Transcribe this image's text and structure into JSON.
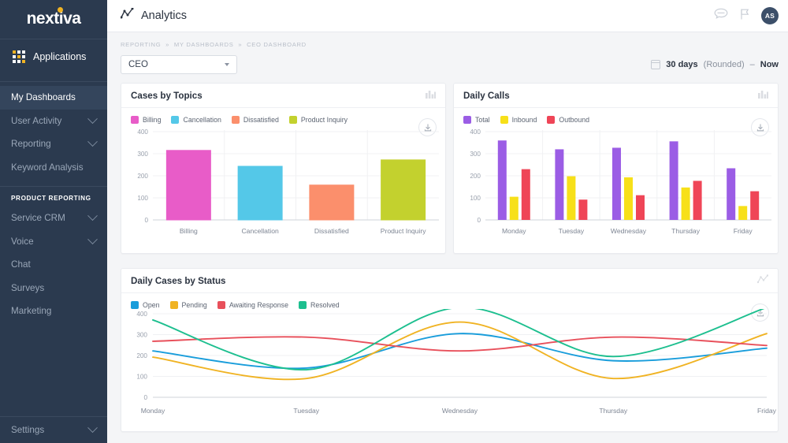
{
  "sidebar": {
    "logo": "nextiva",
    "applications": {
      "label": "Applications",
      "icon": "grid-icon"
    },
    "items": [
      {
        "label": "My Dashboards",
        "active": true,
        "chevron": false
      },
      {
        "label": "User Activity",
        "active": false,
        "chevron": true
      },
      {
        "label": "Reporting",
        "active": false,
        "chevron": true
      },
      {
        "label": "Keyword Analysis",
        "active": false,
        "chevron": false
      }
    ],
    "section_label": "PRODUCT REPORTING",
    "product_items": [
      {
        "label": "Service CRM",
        "chevron": true
      },
      {
        "label": "Voice",
        "chevron": true
      },
      {
        "label": "Chat",
        "chevron": false
      },
      {
        "label": "Surveys",
        "chevron": false
      },
      {
        "label": "Marketing",
        "chevron": false
      }
    ],
    "settings": {
      "label": "Settings",
      "chevron": true
    }
  },
  "topbar": {
    "title": "Analytics",
    "title_icon": "line-chart-icon",
    "icons": [
      {
        "name": "chat-bubble-icon"
      },
      {
        "name": "flag-icon"
      }
    ],
    "avatar_initials": "AS"
  },
  "breadcrumb": {
    "items": [
      "REPORTING",
      "MY DASHBOARDS",
      "CEO DASHBOARD"
    ],
    "separator": "»"
  },
  "controls": {
    "dashboard_select": {
      "value": "CEO",
      "icon": "chevron-down-icon"
    },
    "date_range": {
      "icon": "calendar-icon",
      "amount": "30 days",
      "qualifier": "(Rounded)",
      "dash": "–",
      "end": "Now"
    }
  },
  "colors": {
    "billing": "#e85cc8",
    "cancellation": "#54c8e8",
    "dissatisfied": "#fb8f6c",
    "product_inquiry": "#c3d12e",
    "total": "#9b5de5",
    "inbound": "#f7e019",
    "outbound": "#ef4557",
    "open": "#199ddb",
    "pending": "#f0b323",
    "awaiting": "#e8505b",
    "resolved": "#1dbf8f",
    "sidebar_bg": "#2b3a4f",
    "accent_gold": "#f0b323"
  },
  "cards": {
    "cases_by_topics": {
      "title": "Cases by Topics",
      "head_icon": "bar-chart-icon",
      "download_icon": "download-icon"
    },
    "daily_calls": {
      "title": "Daily Calls",
      "head_icon": "bar-chart-icon",
      "download_icon": "download-icon"
    },
    "daily_cases_by_status": {
      "title": "Daily Cases by Status",
      "head_icon": "line-chart-icon",
      "download_icon": "download-icon"
    }
  },
  "chart_data": [
    {
      "id": "cases-by-topics",
      "type": "bar",
      "title": "Cases by Topics",
      "xlabel": "",
      "ylabel": "",
      "ylim": [
        0,
        400
      ],
      "yticks": [
        0,
        100,
        200,
        300,
        400
      ],
      "grid": true,
      "legend_position": "top-left",
      "categories": [
        "Billing",
        "Cancellation",
        "Dissatisfied",
        "Product Inquiry"
      ],
      "series": [
        {
          "name": "Billing",
          "color": "#e85cc8",
          "values": [
            315,
            null,
            null,
            null
          ]
        },
        {
          "name": "Cancellation",
          "color": "#54c8e8",
          "values": [
            null,
            243,
            null,
            null
          ]
        },
        {
          "name": "Dissatisfied",
          "color": "#fb8f6c",
          "values": [
            null,
            null,
            158,
            null
          ]
        },
        {
          "name": "Product Inquiry",
          "color": "#c3d12e",
          "values": [
            null,
            null,
            null,
            272
          ]
        }
      ],
      "bar_values": [
        315,
        243,
        158,
        272
      ]
    },
    {
      "id": "daily-calls",
      "type": "bar",
      "title": "Daily Calls",
      "xlabel": "",
      "ylabel": "",
      "ylim": [
        0,
        400
      ],
      "yticks": [
        0,
        100,
        200,
        300,
        400
      ],
      "grid": true,
      "legend_position": "top-left",
      "categories": [
        "Monday",
        "Tuesday",
        "Wednesday",
        "Thursday",
        "Friday"
      ],
      "series": [
        {
          "name": "Total",
          "color": "#9b5de5",
          "values": [
            360,
            320,
            327,
            356,
            234
          ]
        },
        {
          "name": "Inbound",
          "color": "#f7e019",
          "values": [
            105,
            198,
            193,
            147,
            63
          ]
        },
        {
          "name": "Outbound",
          "color": "#ef4557",
          "values": [
            230,
            92,
            112,
            177,
            130
          ]
        }
      ]
    },
    {
      "id": "daily-cases-by-status",
      "type": "line",
      "title": "Daily Cases by Status",
      "xlabel": "",
      "ylabel": "",
      "ylim": [
        0,
        400
      ],
      "yticks": [
        0,
        100,
        200,
        300,
        400
      ],
      "grid": true,
      "legend_position": "top-left",
      "categories": [
        "Monday",
        "Tuesday",
        "Wednesday",
        "Thursday",
        "Friday"
      ],
      "x": [
        0,
        1,
        2,
        3,
        4
      ],
      "series": [
        {
          "name": "Open",
          "color": "#199ddb",
          "values": [
            222,
            140,
            305,
            175,
            235
          ]
        },
        {
          "name": "Pending",
          "color": "#f0b323",
          "values": [
            192,
            90,
            360,
            90,
            305
          ]
        },
        {
          "name": "Awaiting Response",
          "color": "#e8505b",
          "values": [
            268,
            288,
            222,
            288,
            248
          ]
        },
        {
          "name": "Resolved",
          "color": "#1dbf8f",
          "values": [
            370,
            132,
            430,
            195,
            430
          ]
        }
      ]
    }
  ]
}
